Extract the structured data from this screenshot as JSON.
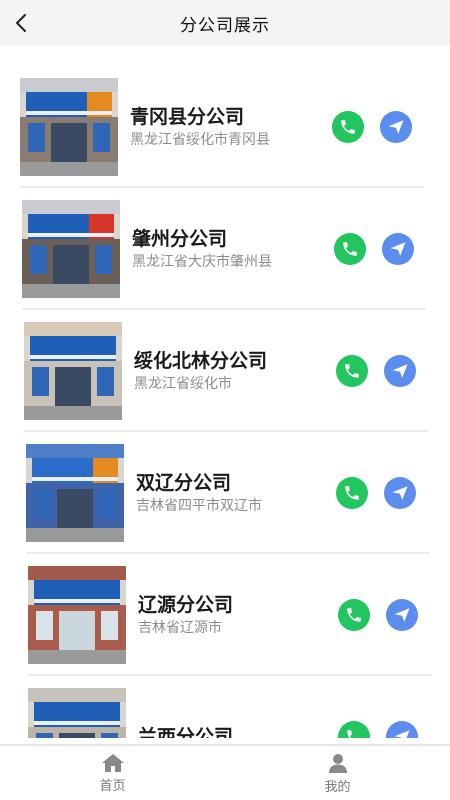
{
  "header": {
    "title": "分公司展示",
    "back_icon": "chevron-left-icon"
  },
  "companies": [
    {
      "name": "青冈县分公司",
      "address": "黑龙江省绥化市青冈县"
    },
    {
      "name": "肇州分公司",
      "address": "黑龙江省大庆市肇州县"
    },
    {
      "name": "绥化北林分公司",
      "address": "黑龙江省绥化市"
    },
    {
      "name": "双辽分公司",
      "address": "吉林省四平市双辽市"
    },
    {
      "name": "辽源分公司",
      "address": "吉林省辽源市"
    },
    {
      "name": "兰西分公司",
      "address": ""
    }
  ],
  "actions": {
    "phone_icon": "phone-icon",
    "send_icon": "send-icon"
  },
  "tabbar": {
    "items": [
      {
        "label": "首页",
        "icon": "home-icon"
      },
      {
        "label": "我的",
        "icon": "user-icon"
      }
    ]
  },
  "colors": {
    "phone": "#22c55e",
    "send": "#5b8def",
    "header_bg": "#f4f4f4"
  }
}
